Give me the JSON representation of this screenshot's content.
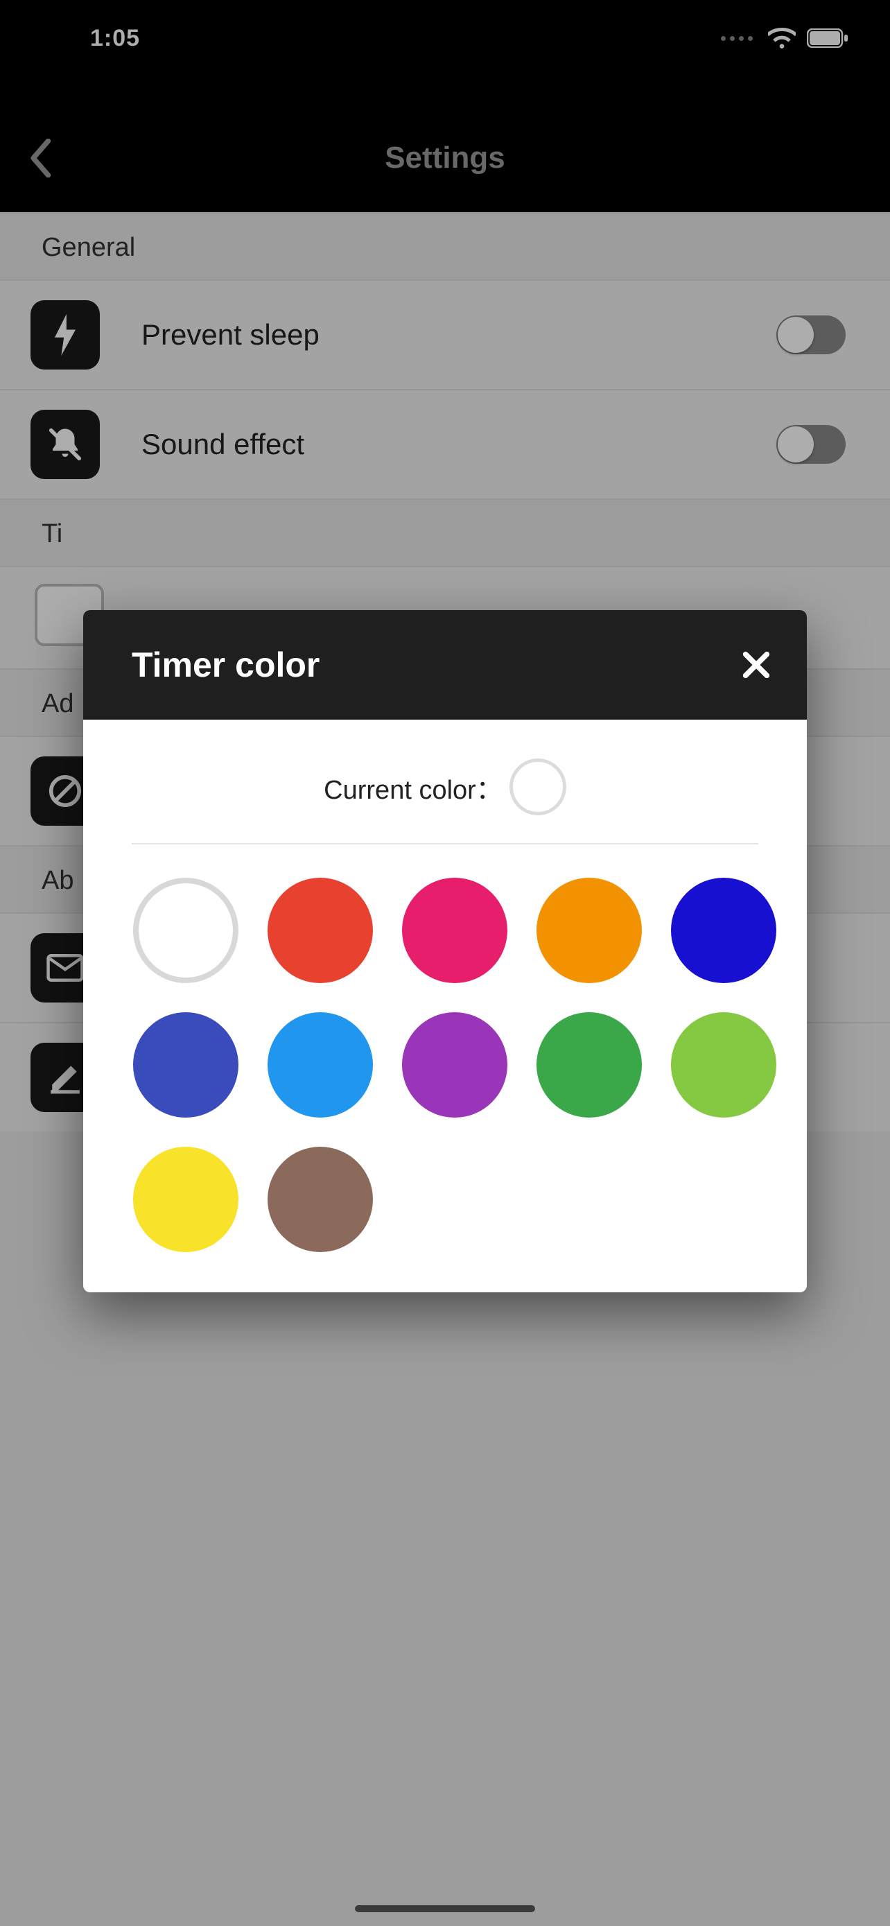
{
  "status": {
    "time": "1:05"
  },
  "nav": {
    "title": "Settings"
  },
  "sections": {
    "general": {
      "header": "General",
      "prevent_sleep_label": "Prevent sleep",
      "sound_effect_label": "Sound effect"
    },
    "timer": {
      "header": "Ti"
    },
    "ads": {
      "header": "Ad"
    },
    "about": {
      "header": "Ab"
    }
  },
  "modal": {
    "title": "Timer color",
    "current_label": "Current color：",
    "current_color": "#ffffff",
    "colors": [
      "#ffffff",
      "#e8412f",
      "#e61e6b",
      "#f29200",
      "#1810d1",
      "#3a4bbb",
      "#2196ee",
      "#9a35b9",
      "#3aa748",
      "#85c942",
      "#f8e22a",
      "#8c6a5b"
    ]
  }
}
